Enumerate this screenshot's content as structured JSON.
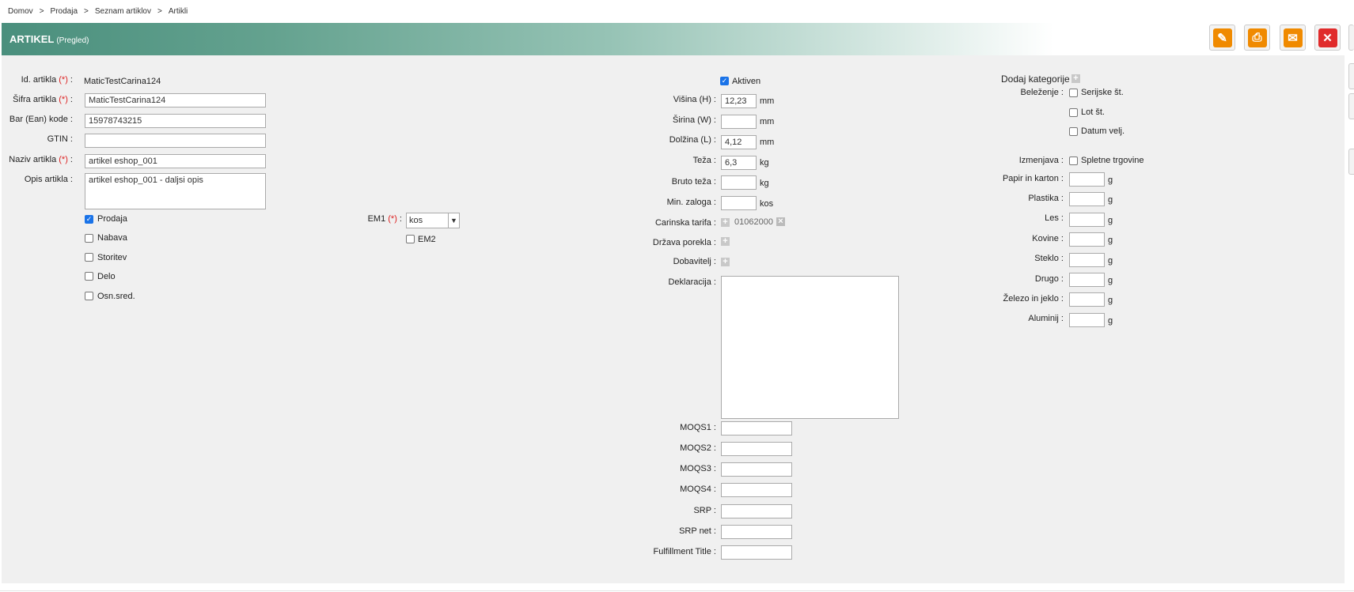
{
  "breadcrumb": [
    "Domov",
    "Prodaja",
    "Seznam artiklov",
    "Artikli"
  ],
  "header": {
    "title": "ARTIKEL",
    "subtitle": "(Pregled)"
  },
  "toolbar": {
    "edit_icon": "pencil-icon",
    "print_icon": "printer-icon",
    "mail_icon": "envelope-icon",
    "close_icon": "close-icon",
    "accent": "#f08a00",
    "close_color": "#e02b2b"
  },
  "left": {
    "id_label": "Id. artikla",
    "req": "(*)",
    "id_value": "MaticTestCarina124",
    "sifra_label": "Šifra artikla",
    "sifra_value": "MaticTestCarina124",
    "bar_label": "Bar (Ean) kode",
    "bar_value": "15978743215",
    "gtin_label": "GTIN",
    "gtin_value": "",
    "naziv_label": "Naziv artikla",
    "naziv_value": "artikel eshop_001",
    "opis_label": "Opis artikla",
    "opis_value": "artikel eshop_001 - daljsi opis",
    "types": [
      {
        "label": "Prodaja",
        "checked": true
      },
      {
        "label": "Nabava",
        "checked": false
      },
      {
        "label": "Storitev",
        "checked": false
      },
      {
        "label": "Delo",
        "checked": false
      },
      {
        "label": "Osn.sred.",
        "checked": false
      }
    ],
    "em1_label": "EM1",
    "em1_value": "kos",
    "em2_label": "EM2"
  },
  "middle": {
    "aktiven_label": "Aktiven",
    "aktiven_checked": true,
    "visina_label": "Višina (H)",
    "visina_value": "12,23",
    "mm": "mm",
    "sirina_label": "Širina (W)",
    "sirina_value": "",
    "dolzina_label": "Dolžina (L)",
    "dolzina_value": "4,12",
    "teza_label": "Teža",
    "teza_value": "6,3",
    "kg": "kg",
    "bruto_label": "Bruto teža",
    "bruto_value": "",
    "minzal_label": "Min. zaloga",
    "minzal_value": "",
    "kos": "kos",
    "carinska_label": "Carinska tarifa",
    "carinska_value": "01062000",
    "drzava_label": "Država porekla",
    "dobavitelj_label": "Dobavitelj",
    "deklaracija_label": "Deklaracija",
    "moqs1_label": "MOQS1",
    "moqs2_label": "MOQS2",
    "moqs3_label": "MOQS3",
    "moqs4_label": "MOQS4",
    "srp_label": "SRP",
    "srpnet_label": "SRP net",
    "fulfill_label": "Fulfillment Title"
  },
  "right": {
    "kategorije_label": "Dodaj kategorije",
    "belezenje_label": "Beleženje",
    "serijske": "Serijske št.",
    "lot": "Lot št.",
    "datum": "Datum velj.",
    "izmenjava_label": "Izmenjava",
    "spletne": "Spletne trgovine",
    "packaging": [
      "Papir in karton",
      "Plastika",
      "Les",
      "Kovine",
      "Steklo",
      "Drugo",
      "Železo in jeklo",
      "Aluminij"
    ],
    "g": "g"
  }
}
